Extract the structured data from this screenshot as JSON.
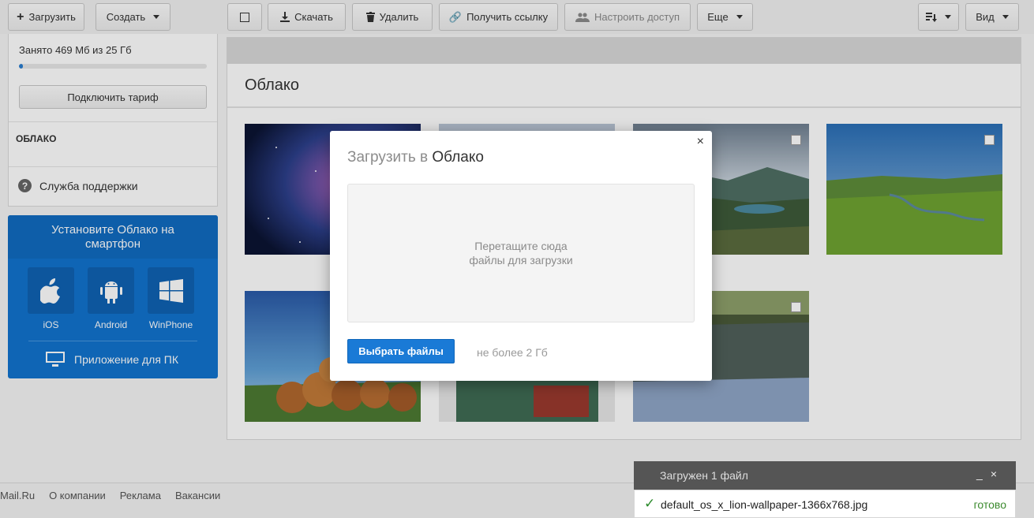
{
  "toolbar": {
    "upload": "Загрузить",
    "create": "Создать",
    "download": "Скачать",
    "delete": "Удалить",
    "get_link": "Получить ссылку",
    "access": "Настроить доступ",
    "more": "Еще",
    "view": "Вид"
  },
  "sidebar": {
    "quota": "Занято 469 Мб из 25 Гб",
    "quota_fraction": 0.018,
    "tariff_button": "Подключить тариф",
    "cloud_label": "ОБЛАКО",
    "support": "Служба поддержки",
    "promo": {
      "title_line1": "Установите Облако на",
      "title_line2": "смартфон",
      "apps": [
        "iOS",
        "Android",
        "WinPhone"
      ],
      "pc_app": "Приложение для ПК"
    }
  },
  "main": {
    "title": "Облако"
  },
  "modal": {
    "title_prefix": "Загрузить в ",
    "title_dest": "Облако",
    "dropzone_line1": "Перетащите сюда",
    "dropzone_line2": "файлы для загрузки",
    "choose_button": "Выбрать файлы",
    "limit": "не более 2 Гб"
  },
  "upload_status": {
    "title": "Загружен 1 файл",
    "file": "default_os_x_lion-wallpaper-1366x768.jpg",
    "status": "готово"
  },
  "footer": {
    "links": [
      "Mail.Ru",
      "О компании",
      "Реклама",
      "Вакансии"
    ]
  },
  "colors": {
    "accent": "#1a7ad6",
    "promo": "#1273cf",
    "success": "#3b8a2e"
  }
}
